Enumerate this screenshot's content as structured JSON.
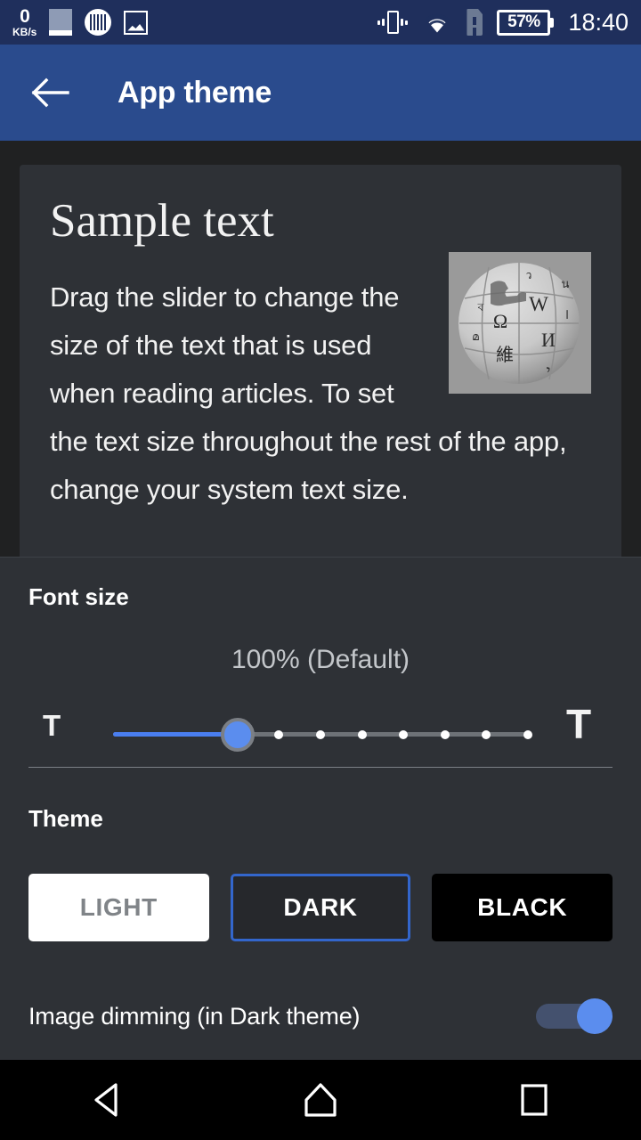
{
  "status_bar": {
    "net_speed_value": "0",
    "net_speed_unit": "KB/s",
    "battery_percent": "57%",
    "clock": "18:40",
    "icons": [
      "screen-recorder-icon",
      "barcode-icon",
      "photo-icon",
      "vibrate-icon",
      "wifi-icon",
      "sd-card-alert-icon",
      "battery-icon"
    ]
  },
  "app_bar": {
    "back_icon": "back-arrow-icon",
    "title": "App theme"
  },
  "preview_card": {
    "heading": "Sample text",
    "body": "Drag the slider to change the size of the text that is used when reading articles. To set the text size throughout the rest of the app, change your system text size.",
    "image_alt": "wikipedia-globe-logo"
  },
  "font_size": {
    "label": "Font size",
    "value_text": "100% (Default)",
    "small_t": "T",
    "large_t": "T",
    "current_step": 3,
    "total_steps": 11,
    "accent_color": "#4a7ef0"
  },
  "theme": {
    "label": "Theme",
    "options": [
      {
        "label": "LIGHT",
        "selected": false
      },
      {
        "label": "DARK",
        "selected": true
      },
      {
        "label": "BLACK",
        "selected": false
      }
    ],
    "selected_border_color": "#3366cc"
  },
  "image_dimming": {
    "label": "Image dimming (in Dark theme)",
    "enabled": true,
    "accent_color": "#5b8dee"
  },
  "nav_bar": {
    "back": "nav-back-icon",
    "home": "nav-home-icon",
    "recents": "nav-recents-icon"
  }
}
